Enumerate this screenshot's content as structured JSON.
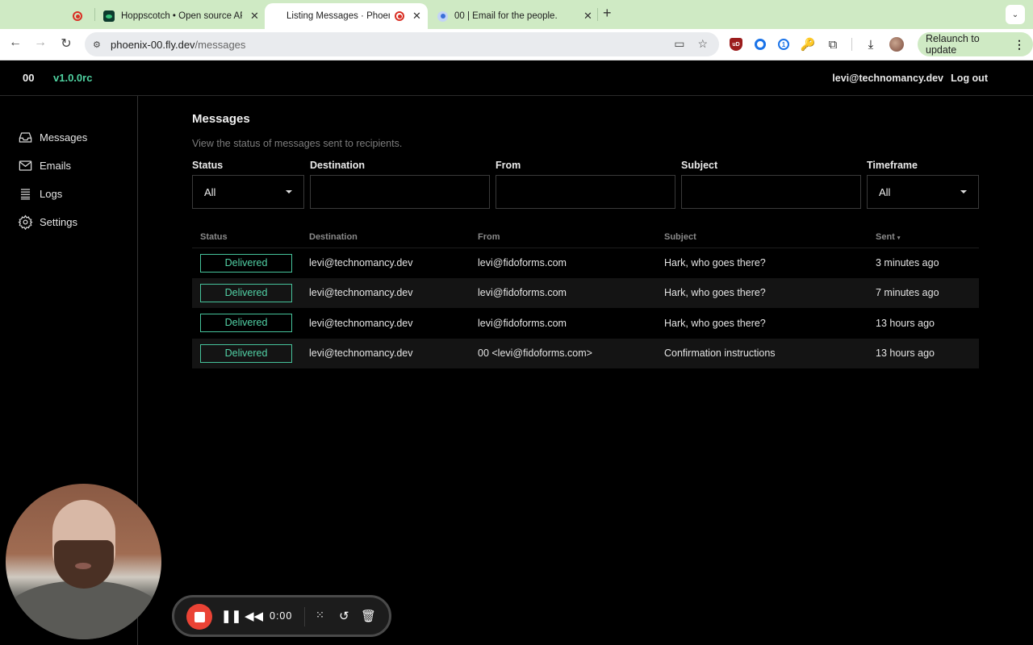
{
  "browser": {
    "tabs": [
      {
        "title": "",
        "icon": "recording-dot-icon"
      },
      {
        "title": "Hoppscotch • Open source API",
        "icon": "hoppscotch-favicon"
      },
      {
        "title": "Listing Messages · Phoeni",
        "icon": "recording-dot-icon",
        "active": true
      },
      {
        "title": "00 | Email for the people.",
        "icon": "00-favicon"
      }
    ],
    "url_host": "phoenix-00.fly.dev",
    "url_path": "/messages",
    "relaunch_label": "Relaunch to update",
    "ublock_label": "uD",
    "onepassword_label": "1"
  },
  "header": {
    "brand": "00",
    "version": "v1.0.0rc",
    "user_email": "levi@technomancy.dev",
    "logout_label": "Log out"
  },
  "sidebar": {
    "items": [
      {
        "label": "Messages",
        "icon": "inbox-icon"
      },
      {
        "label": "Emails",
        "icon": "envelope-icon"
      },
      {
        "label": "Logs",
        "icon": "logs-icon"
      },
      {
        "label": "Settings",
        "icon": "gear-icon"
      }
    ]
  },
  "page": {
    "title": "Messages",
    "subtitle": "View the status of messages sent to recipients."
  },
  "filters": {
    "status": {
      "label": "Status",
      "value": "All"
    },
    "destination": {
      "label": "Destination",
      "value": "",
      "placeholder": ""
    },
    "from": {
      "label": "From",
      "value": "",
      "placeholder": ""
    },
    "subject": {
      "label": "Subject",
      "value": "",
      "placeholder": ""
    },
    "timeframe": {
      "label": "Timeframe",
      "value": "All"
    }
  },
  "table": {
    "columns": [
      "Status",
      "Destination",
      "From",
      "Subject",
      "Sent"
    ],
    "sort_column": "Sent",
    "sort_indicator": "▾",
    "rows": [
      {
        "status": "Delivered",
        "destination": "levi@technomancy.dev",
        "from": "levi@fidoforms.com",
        "subject": "Hark, who goes there?",
        "sent": "3 minutes ago"
      },
      {
        "status": "Delivered",
        "destination": "levi@technomancy.dev",
        "from": "levi@fidoforms.com",
        "subject": "Hark, who goes there?",
        "sent": "7 minutes ago"
      },
      {
        "status": "Delivered",
        "destination": "levi@technomancy.dev",
        "from": "levi@fidoforms.com",
        "subject": "Hark, who goes there?",
        "sent": "13 hours ago"
      },
      {
        "status": "Delivered",
        "destination": "levi@technomancy.dev",
        "from": "00 <levi@fidoforms.com>",
        "subject": "Confirmation instructions",
        "sent": "13 hours ago"
      }
    ]
  },
  "recorder": {
    "time": "0:00"
  },
  "colors": {
    "accent": "#4fd1a0",
    "delivered": "#52d2a6",
    "record": "#ea4335"
  }
}
